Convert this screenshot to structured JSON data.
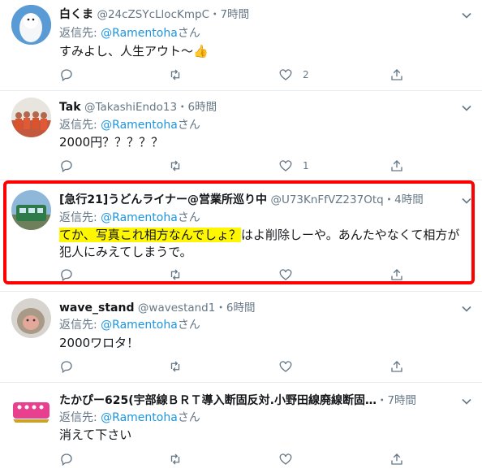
{
  "colors": {
    "accent": "#1b95e0",
    "highlight_box": "#ff0000",
    "text_highlight": "#fff700"
  },
  "tweets": [
    {
      "name": "白くま",
      "handle": "@24cZSYcLlocKmpC",
      "time": "・7時間",
      "reply_prefix": "返信先: ",
      "reply_mention": "@Ramentoha",
      "reply_suffix": "さん",
      "text": "すみよし、人生アウト〜👍",
      "likes": "2"
    },
    {
      "name": "Tak",
      "handle": "@TakashiEndo13",
      "time": "・6時間",
      "reply_prefix": "返信先: ",
      "reply_mention": "@Ramentoha",
      "reply_suffix": "さん",
      "text": "2000円？？？？？",
      "likes": "1"
    },
    {
      "name": "[急行21]うどんライナー@営業所巡り中",
      "handle": "@U73KnFfVZ237Otq",
      "time": "・4時間",
      "reply_prefix": "返信先: ",
      "reply_mention": "@Ramentoha",
      "reply_suffix": "さん",
      "text_highlight": "てか、写真これ相方なんでしょ？",
      "text_rest": "はよ削除しーや。あんたやなくて相方が犯人にみえてしまうで。",
      "likes": ""
    },
    {
      "name": "wave_stand",
      "handle": "@wavestand1",
      "time": "・6時間",
      "reply_prefix": "返信先: ",
      "reply_mention": "@Ramentoha",
      "reply_suffix": "さん",
      "text": "2000ワロタ！",
      "likes": ""
    },
    {
      "name": "たかぴー625(宇部線ＢＲＴ導入断固反対.小野田線廃線断固…",
      "handle": "",
      "time": "・7時間",
      "reply_prefix": "返信先: ",
      "reply_mention": "@Ramentoha",
      "reply_suffix": "さん",
      "text": "消えて下さい",
      "likes": ""
    }
  ]
}
